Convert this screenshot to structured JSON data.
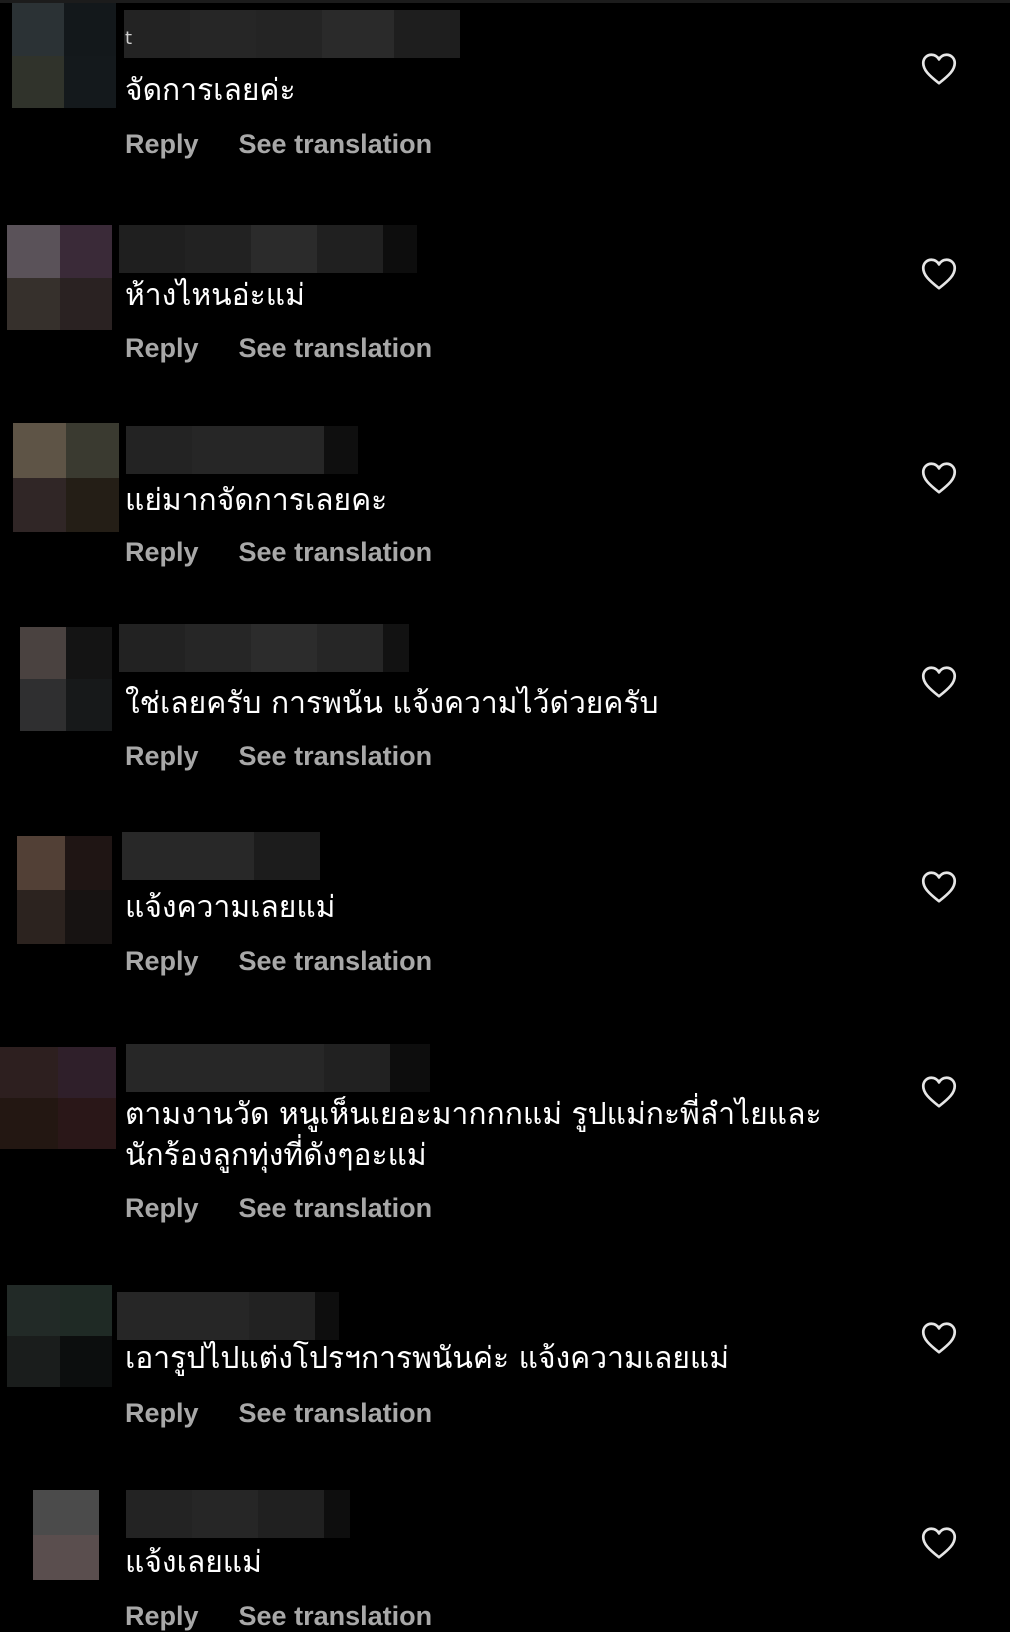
{
  "actions": {
    "reply": "Reply",
    "see_translation": "See translation"
  },
  "colors": {
    "background": "#000000",
    "comment_text": "#ffffff",
    "action_text": "#a8a8a8",
    "heart_outline": "#e6e6e6"
  },
  "comments": [
    {
      "text": "จัดการเลยค่ะ",
      "username_glyph": "t"
    },
    {
      "text": "ห้างไหนอ่ะแม่"
    },
    {
      "text": "แย่มากจัดการเลยคะ"
    },
    {
      "text": "ใช่เลยครับ การพนัน แจ้งความไว้ด่วยครับ"
    },
    {
      "text": "แจ้งความเลยแม่"
    },
    {
      "text": "ตามงานวัด หนูเห็นเยอะมากกกแม่ รูปแม่กะพี่ลำไยและ\nนักร้องลูกทุ่งที่ดังๆอะแม่"
    },
    {
      "text": "เอารูปไปแต่งโปรฯการพนันค่ะ แจ้งความเลยแม่"
    },
    {
      "text": "แจ้งเลยแม่"
    }
  ]
}
